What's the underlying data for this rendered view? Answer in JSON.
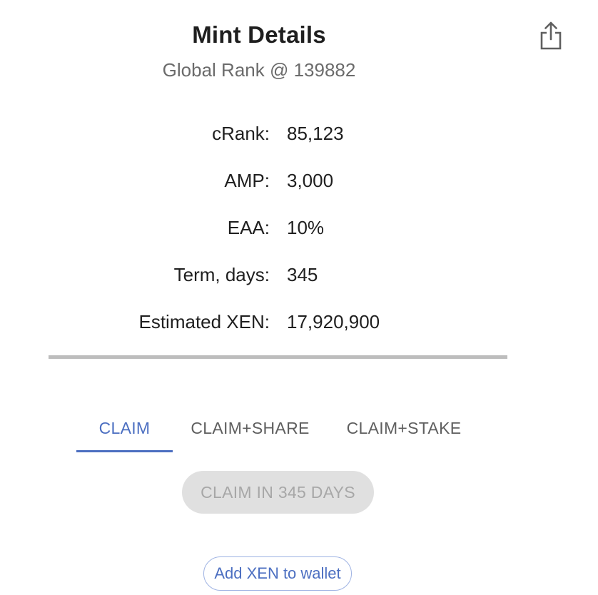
{
  "header": {
    "title": "Mint Details",
    "subtitle": "Global Rank @ 139882",
    "share_icon": "share-icon"
  },
  "details": [
    {
      "label": "cRank:",
      "value": "85,123"
    },
    {
      "label": "AMP:",
      "value": "3,000"
    },
    {
      "label": "EAA:",
      "value": "10%"
    },
    {
      "label": "Term, days:",
      "value": "345"
    },
    {
      "label": "Estimated XEN:",
      "value": "17,920,900"
    }
  ],
  "tabs": [
    {
      "label": "CLAIM",
      "selected": true
    },
    {
      "label": "CLAIM+SHARE",
      "selected": false
    },
    {
      "label": "CLAIM+STAKE",
      "selected": false
    }
  ],
  "claim_button": {
    "label": "CLAIM IN 345 DAYS",
    "disabled": true
  },
  "wallet_button": {
    "label": "Add XEN to wallet"
  },
  "colors": {
    "accent": "#4c6fc1",
    "divider": "#bdbdbd",
    "disabled_bg": "#e0e0e0",
    "disabled_text": "#a7a7a7"
  }
}
